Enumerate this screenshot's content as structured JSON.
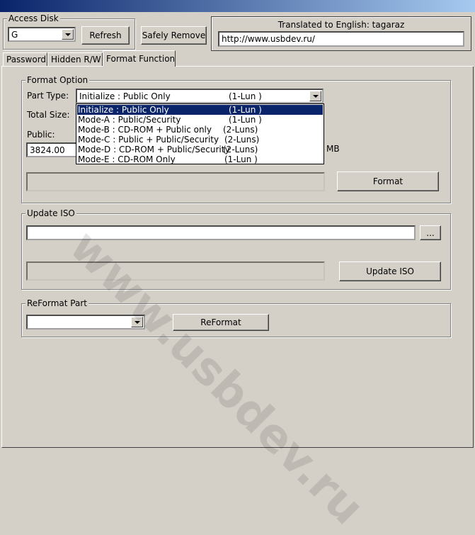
{
  "access_disk": {
    "group_label": "Access Disk",
    "drive_value": "G",
    "refresh_label": "Refresh",
    "safely_remove_label": "Safely Remove"
  },
  "translation": {
    "note": "Translated to English: tagaraz",
    "url": "http://www.usbdev.ru/"
  },
  "tabs": [
    "Password",
    "Hidden R/W",
    "Format Function"
  ],
  "format_option": {
    "group_label": "Format Option",
    "part_type_label": "Part Type:",
    "part_type_value": "Initialize : Public Only",
    "part_type_lun": "(1-Lun  )",
    "total_size_label": "Total Size:",
    "public_label": "Public:",
    "public_value": "3824.00",
    "mb_label": "MB",
    "format_label": "Format",
    "options": [
      {
        "name": "Initialize : Public Only",
        "lun": "(1-Lun  )"
      },
      {
        "name": "Mode-A : Public/Security",
        "lun": "(1-Lun  )"
      },
      {
        "name": "Mode-B : CD-ROM + Public only",
        "lun": "(2-Luns)"
      },
      {
        "name": "Mode-C : Public + Public/Security",
        "lun": "(2-Luns)"
      },
      {
        "name": "Mode-D : CD-ROM + Public/Security",
        "lun": "(2-Luns)"
      },
      {
        "name": "Mode-E : CD-ROM Only",
        "lun": "(1-Lun  )"
      }
    ]
  },
  "update_iso": {
    "group_label": "Update ISO",
    "path_value": "",
    "browse_label": "...",
    "update_label": "Update ISO"
  },
  "reformat_part": {
    "group_label": "ReFormat Part",
    "select_value": "",
    "reformat_label": "ReFormat"
  },
  "watermark": "www.usbdev.ru"
}
